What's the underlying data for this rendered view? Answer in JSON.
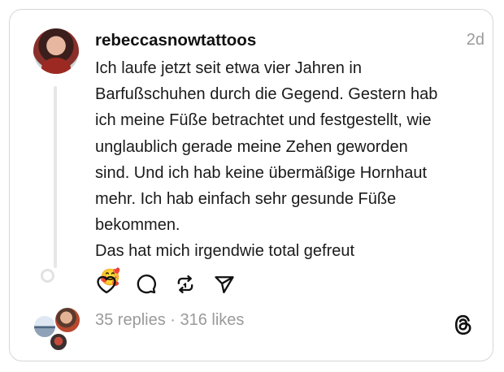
{
  "post": {
    "username": "rebeccasnowtattoos",
    "timestamp": "2d",
    "lines": [
      "Ich laufe jetzt seit etwa vier Jahren in",
      "Barfußschuhen durch die Gegend. Gestern hab",
      "ich meine Füße betrachtet und festgestellt, wie",
      "unglaublich gerade meine Zehen geworden",
      "sind. Und ich hab keine übermäßige Hornhaut",
      "mehr. Ich hab einfach sehr gesunde Füße",
      "bekommen.",
      "Das hat mich irgendwie total gefreut"
    ],
    "emoji": "🥰"
  },
  "stats": {
    "text": "35 replies · 316 likes"
  },
  "icons": {
    "like": "heart-icon",
    "reply": "comment-icon",
    "repost": "repost-icon",
    "share": "send-icon",
    "brand": "threads-logo-icon"
  }
}
